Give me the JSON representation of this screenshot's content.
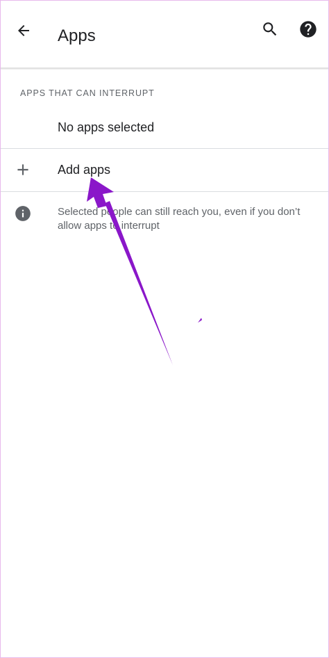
{
  "header": {
    "title": "Apps"
  },
  "section": {
    "header": "APPS THAT CAN INTERRUPT",
    "empty_text": "No apps selected",
    "add_label": "Add apps"
  },
  "info": {
    "text": "Selected people can still reach you, even if you don’t allow apps to interrupt"
  },
  "icons": {
    "back": "arrow-back-icon",
    "search": "search-icon",
    "help": "help-icon",
    "add": "plus-icon",
    "info": "info-icon"
  },
  "colors": {
    "annotation_arrow": "#8a17c9",
    "text_primary": "#202124",
    "text_secondary": "#5f6368"
  }
}
